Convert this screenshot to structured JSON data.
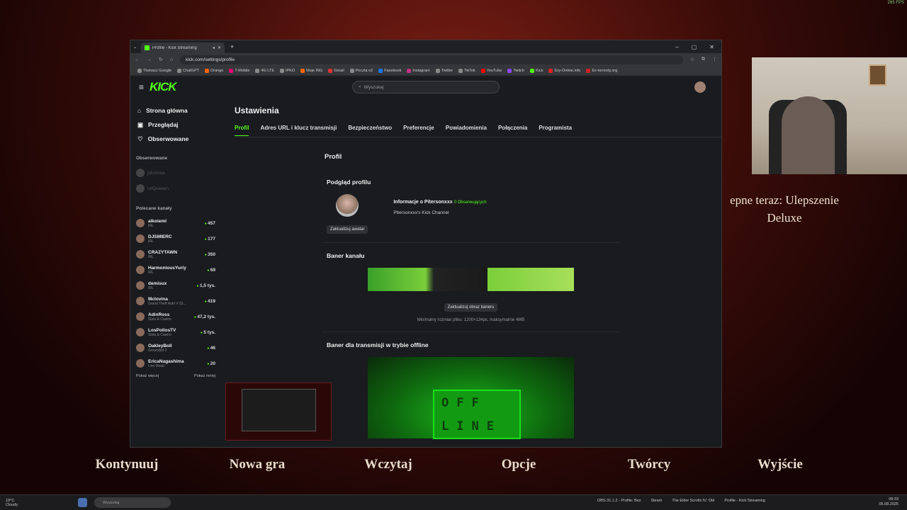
{
  "fps": "265 FPS",
  "browser": {
    "tab_title": "Profile - Kick Streaming",
    "url": "kick.com/settings/profile",
    "bookmarks": [
      "Tłumacz Google",
      "ChatGPT",
      "Orange",
      "T-Mobile",
      "4G LTE",
      "IPKO",
      "Moje ING",
      "Gmail",
      "Poczta o2",
      "Facebook",
      "Instagram",
      "Twitter",
      "TikTok",
      "YouTube",
      "Twitch",
      "Kick",
      "Gry-Online.info",
      "Ex-torrenty.org"
    ]
  },
  "kick": {
    "logo": "KICK",
    "search_placeholder": "Wyszukaj",
    "nav": {
      "home": "Strona główna",
      "browse": "Przeglądaj",
      "followed": "Obserwowane"
    },
    "followed_header": "Obserwowane",
    "followed": [
      {
        "name": "julczixxa"
      },
      {
        "name": "UrQueeen"
      }
    ],
    "recommended_header": "Polecane kanały",
    "recommended": [
      {
        "name": "alkoieml",
        "category": "IRL",
        "viewers": "457"
      },
      {
        "name": "DJSMIERC",
        "category": "IRL",
        "viewers": "177"
      },
      {
        "name": "CRAZYTAWN",
        "category": "IRL",
        "viewers": "350"
      },
      {
        "name": "HarmoniousYuriy",
        "category": "IRL",
        "viewers": "69"
      },
      {
        "name": "demisux",
        "category": "IRL",
        "viewers": "1,5 tys."
      },
      {
        "name": "Mclovina",
        "category": "Grand Theft Auto V (G...",
        "viewers": "419"
      },
      {
        "name": "AdinRoss",
        "category": "Slots & Casino",
        "viewers": "47,2 tys."
      },
      {
        "name": "LosPollosTV",
        "category": "Slots & Casino",
        "viewers": "5 tys."
      },
      {
        "name": "OakleyBoll",
        "category": "Grounded 2",
        "viewers": "46"
      },
      {
        "name": "EricaNagashima",
        "category": "Live Music",
        "viewers": "20"
      }
    ],
    "show_more": "Pokaż więcej",
    "show_less": "Pokaż mniej",
    "settings_title": "Ustawienia",
    "tabs": [
      "Profil",
      "Adres URL i klucz transmisji",
      "Bezpieczeństwo",
      "Preferencje",
      "Powiadomienia",
      "Połączenia",
      "Programista"
    ],
    "section_title": "Profil",
    "preview_title": "Podgląd profilu",
    "profile_info": "Informacje o Pitersonxxx",
    "followers": "0 Obserwujących",
    "channel_desc": "Pitersonxxx's Kick Channel",
    "update_avatar": "Zaktualizuj awatar",
    "banner_title": "Baner kanału",
    "update_banner": "Zaktualizuj obraz baneru",
    "banner_hint": "Minimalny rozmiar pliku: 1200×134px, maksymalnie 4MB",
    "offline_title": "Baner dla transmisji w trybie offline",
    "offline_row1": "OFF",
    "offline_row2": "LINE"
  },
  "overlay": {
    "up_next_line1": "epne teraz: Ulepszenie",
    "up_next_line2": "Deluxe"
  },
  "game_menu": [
    "Kontynuuj",
    "Nowa gra",
    "Wczytaj",
    "Opcje",
    "Twórcy",
    "Wyjście"
  ],
  "taskbar": {
    "weather_temp": "19°C",
    "weather_desc": "Cloudy",
    "search_placeholder": "Wyszukaj",
    "apps": [
      "OBS 31.1.2 - Profile: Bez",
      "Steam",
      "The Elder Scrolls IV: Obl",
      "Profile - Kick Streaming"
    ],
    "time": "08:33",
    "date": "05.08.2025"
  }
}
